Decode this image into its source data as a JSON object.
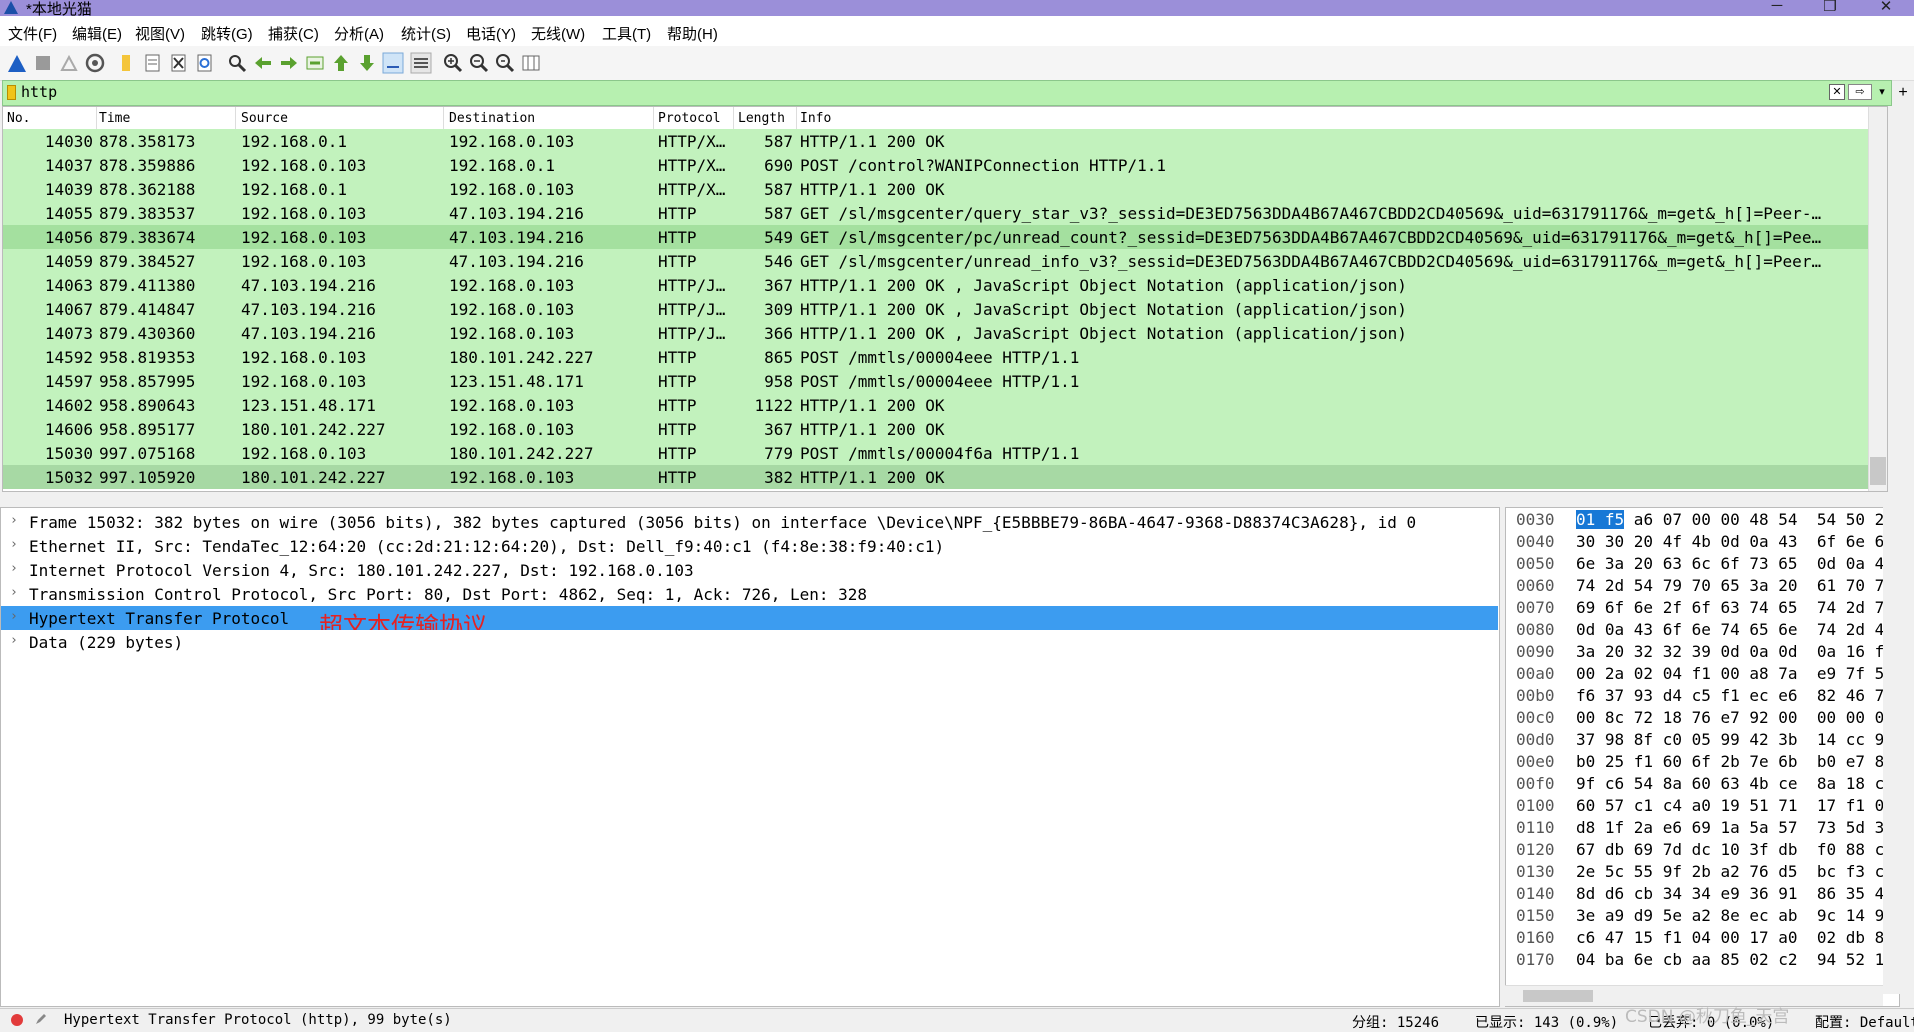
{
  "window": {
    "title": "*本地光猫",
    "minimize": "─",
    "maximize": "❐",
    "close": "✕"
  },
  "menu": [
    "文件(F)",
    "编辑(E)",
    "视图(V)",
    "跳转(G)",
    "捕获(C)",
    "分析(A)",
    "统计(S)",
    "电话(Y)",
    "无线(W)",
    "工具(T)",
    "帮助(H)"
  ],
  "filter": {
    "value": "http",
    "clear": "✕",
    "apply": "⇨",
    "dropdown": "▾",
    "add": "+"
  },
  "columns": [
    "No.",
    "Time",
    "Source",
    "Destination",
    "Protocol",
    "Length",
    "Info"
  ],
  "packets": [
    {
      "no": "14030",
      "time": "878.358173",
      "src": "192.168.0.1",
      "dst": "192.168.0.103",
      "proto": "HTTP/X…",
      "len": "587",
      "info": "HTTP/1.1 200 OK"
    },
    {
      "no": "14037",
      "time": "878.359886",
      "src": "192.168.0.103",
      "dst": "192.168.0.1",
      "proto": "HTTP/X…",
      "len": "690",
      "info": "POST /control?WANIPConnection HTTP/1.1"
    },
    {
      "no": "14039",
      "time": "878.362188",
      "src": "192.168.0.1",
      "dst": "192.168.0.103",
      "proto": "HTTP/X…",
      "len": "587",
      "info": "HTTP/1.1 200 OK"
    },
    {
      "no": "14055",
      "time": "879.383537",
      "src": "192.168.0.103",
      "dst": "47.103.194.216",
      "proto": "HTTP",
      "len": "587",
      "info": "GET /sl/msgcenter/query_star_v3?_sessid=DE3ED7563DDA4B67A467CBDD2CD40569&_uid=631791176&_m=get&_h[]=Peer-…"
    },
    {
      "no": "14056",
      "time": "879.383674",
      "src": "192.168.0.103",
      "dst": "47.103.194.216",
      "proto": "HTTP",
      "len": "549",
      "info": "GET /sl/msgcenter/pc/unread_count?_sessid=DE3ED7563DDA4B67A467CBDD2CD40569&_uid=631791176&_m=get&_h[]=Pee…"
    },
    {
      "no": "14059",
      "time": "879.384527",
      "src": "192.168.0.103",
      "dst": "47.103.194.216",
      "proto": "HTTP",
      "len": "546",
      "info": "GET /sl/msgcenter/unread_info_v3?_sessid=DE3ED7563DDA4B67A467CBDD2CD40569&_uid=631791176&_m=get&_h[]=Peer…"
    },
    {
      "no": "14063",
      "time": "879.411380",
      "src": "47.103.194.216",
      "dst": "192.168.0.103",
      "proto": "HTTP/J…",
      "len": "367",
      "info": "HTTP/1.1 200 OK , JavaScript Object Notation (application/json)"
    },
    {
      "no": "14067",
      "time": "879.414847",
      "src": "47.103.194.216",
      "dst": "192.168.0.103",
      "proto": "HTTP/J…",
      "len": "309",
      "info": "HTTP/1.1 200 OK , JavaScript Object Notation (application/json)"
    },
    {
      "no": "14073",
      "time": "879.430360",
      "src": "47.103.194.216",
      "dst": "192.168.0.103",
      "proto": "HTTP/J…",
      "len": "366",
      "info": "HTTP/1.1 200 OK , JavaScript Object Notation (application/json)"
    },
    {
      "no": "14592",
      "time": "958.819353",
      "src": "192.168.0.103",
      "dst": "180.101.242.227",
      "proto": "HTTP",
      "len": "865",
      "info": "POST /mmtls/00004eee HTTP/1.1"
    },
    {
      "no": "14597",
      "time": "958.857995",
      "src": "192.168.0.103",
      "dst": "123.151.48.171",
      "proto": "HTTP",
      "len": "958",
      "info": "POST /mmtls/00004eee HTTP/1.1"
    },
    {
      "no": "14602",
      "time": "958.890643",
      "src": "123.151.48.171",
      "dst": "192.168.0.103",
      "proto": "HTTP",
      "len": "1122",
      "info": "HTTP/1.1 200 OK"
    },
    {
      "no": "14606",
      "time": "958.895177",
      "src": "180.101.242.227",
      "dst": "192.168.0.103",
      "proto": "HTTP",
      "len": "367",
      "info": "HTTP/1.1 200 OK"
    },
    {
      "no": "15030",
      "time": "997.075168",
      "src": "192.168.0.103",
      "dst": "180.101.242.227",
      "proto": "HTTP",
      "len": "779",
      "info": "POST /mmtls/00004f6a HTTP/1.1"
    },
    {
      "no": "15032",
      "time": "997.105920",
      "src": "180.101.242.227",
      "dst": "192.168.0.103",
      "proto": "HTTP",
      "len": "382",
      "info": "HTTP/1.1 200 OK"
    }
  ],
  "details": [
    {
      "text": "Frame 15032: 382 bytes on wire (3056 bits), 382 bytes captured (3056 bits) on interface \\Device\\NPF_{E5BBBE79-86BA-4647-9368-D88374C3A628}, id 0"
    },
    {
      "text": "Ethernet II, Src: TendaTec_12:64:20 (cc:2d:21:12:64:20), Dst: Dell_f9:40:c1 (f4:8e:38:f9:40:c1)"
    },
    {
      "text": "Internet Protocol Version 4, Src: 180.101.242.227, Dst: 192.168.0.103"
    },
    {
      "text": "Transmission Control Protocol, Src Port: 80, Dst Port: 4862, Seq: 1, Ack: 726, Len: 328"
    },
    {
      "text": "Hypertext Transfer Protocol",
      "note": "超文本传输协议"
    },
    {
      "text": "Data (229 bytes)"
    }
  ],
  "hex": [
    {
      "off": "0030",
      "sel": "01 f5",
      "bytes": " a6 07 00 00 48 54  54 50 2"
    },
    {
      "off": "0040",
      "bytes": "30 30 20 4f 4b 0d 0a 43  6f 6e 6"
    },
    {
      "off": "0050",
      "bytes": "6e 3a 20 63 6c 6f 73 65  0d 0a 4"
    },
    {
      "off": "0060",
      "bytes": "74 2d 54 79 70 65 3a 20  61 70 7"
    },
    {
      "off": "0070",
      "bytes": "69 6f 6e 2f 6f 63 74 65  74 2d 7"
    },
    {
      "off": "0080",
      "bytes": "0d 0a 43 6f 6e 74 65 6e  74 2d 4"
    },
    {
      "off": "0090",
      "bytes": "3a 20 32 32 39 0d 0a 0d  0a 16 f"
    },
    {
      "off": "00a0",
      "bytes": "00 2a 02 04 f1 00 a8 7a  e9 7f 5"
    },
    {
      "off": "00b0",
      "bytes": "f6 37 93 d4 c5 f1 ec e6  82 46 7"
    },
    {
      "off": "00c0",
      "bytes": "00 8c 72 18 76 e7 92 00  00 00 0"
    },
    {
      "off": "00d0",
      "bytes": "37 98 8f c0 05 99 42 3b  14 cc 9"
    },
    {
      "off": "00e0",
      "bytes": "b0 25 f1 60 6f 2b 7e 6b  b0 e7 8"
    },
    {
      "off": "00f0",
      "bytes": "9f c6 54 8a 60 63 4b ce  8a 18 c"
    },
    {
      "off": "0100",
      "bytes": "60 57 c1 c4 a0 19 51 71  17 f1 0"
    },
    {
      "off": "0110",
      "bytes": "d8 1f 2a e6 69 1a 5a 57  73 5d 3"
    },
    {
      "off": "0120",
      "bytes": "67 db 69 7d dc 10 3f db  f0 88 c"
    },
    {
      "off": "0130",
      "bytes": "2e 5c 55 9f 2b a2 76 d5  bc f3 c"
    },
    {
      "off": "0140",
      "bytes": "8d d6 cb 34 34 e9 36 91  86 35 4"
    },
    {
      "off": "0150",
      "bytes": "3e a9 d9 5e a2 8e ec ab  9c 14 9"
    },
    {
      "off": "0160",
      "bytes": "c6 47 15 f1 04 00 17 a0  02 db 8"
    },
    {
      "off": "0170",
      "bytes": "04 ba 6e cb aa 85 02 c2  94 52 1"
    }
  ],
  "status": {
    "field": "Hypertext Transfer Protocol (http), 99 byte(s)",
    "packets": "分组: 15246",
    "displayed": "已显示: 143 (0.9%)",
    "dropped": "已丢弃: 0 (0.0%)",
    "profile": "配置: Default"
  },
  "watermark": "CSDN @秋刀鱼_天宫"
}
